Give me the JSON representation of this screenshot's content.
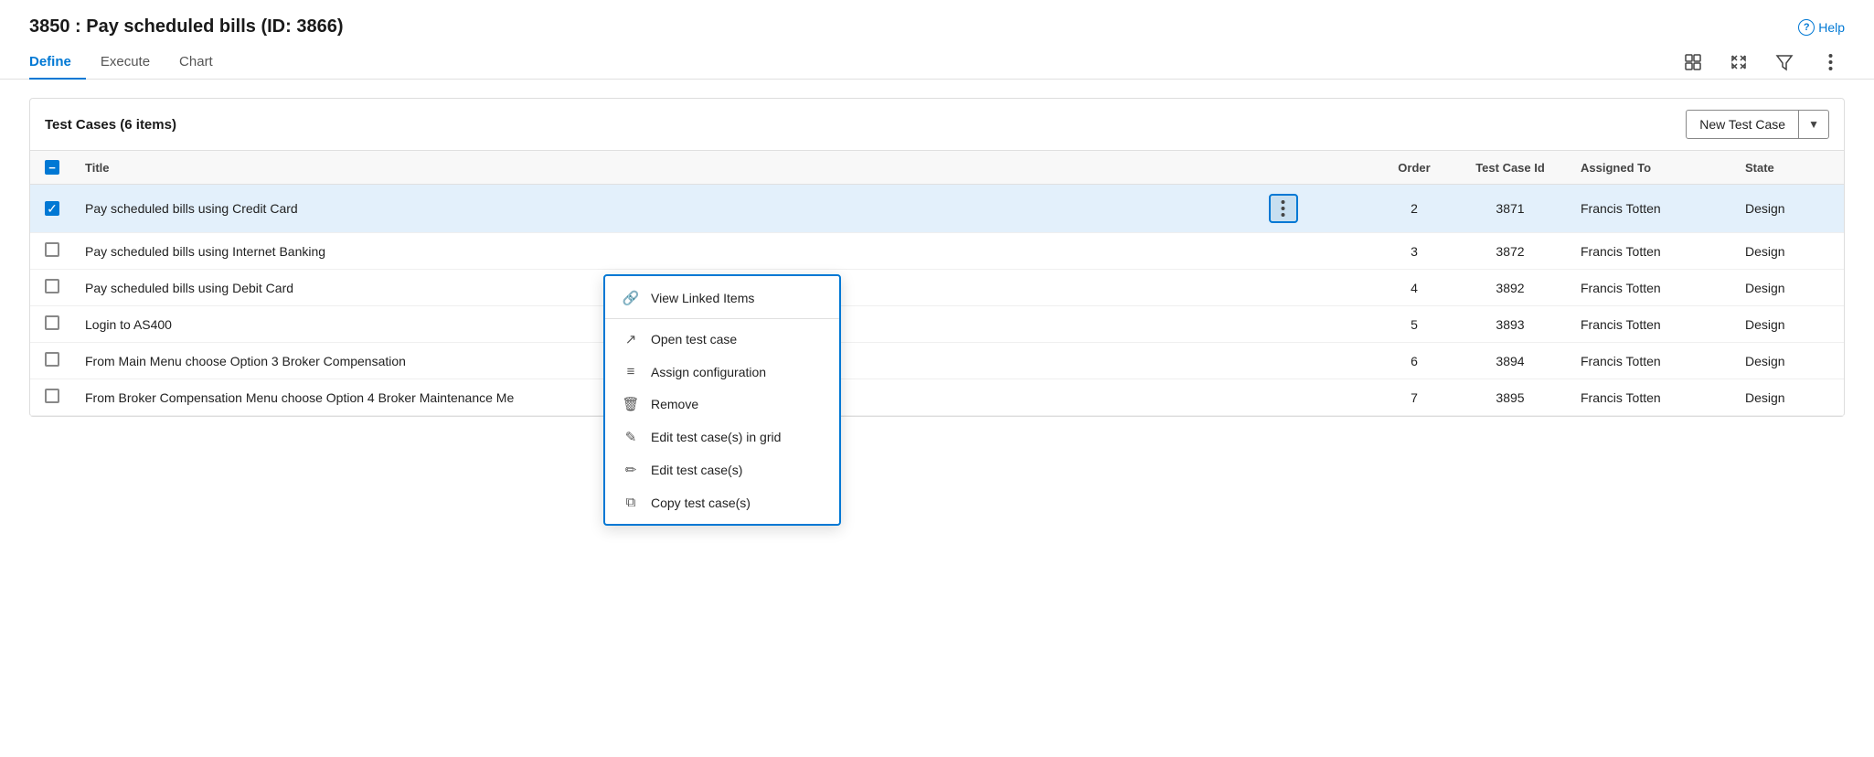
{
  "page": {
    "title": "3850 : Pay scheduled bills (ID: 3866)",
    "help_label": "Help"
  },
  "tabs": {
    "items": [
      {
        "id": "define",
        "label": "Define",
        "active": true
      },
      {
        "id": "execute",
        "label": "Execute",
        "active": false
      },
      {
        "id": "chart",
        "label": "Chart",
        "active": false
      }
    ]
  },
  "toolbar": {
    "grid_icon": "⊞",
    "expand_icon": "⤢",
    "filter_icon": "⊽",
    "more_icon": "⋮"
  },
  "panel": {
    "title": "Test Cases (6 items)",
    "new_btn_label": "New Test Case",
    "new_btn_chevron": "▼"
  },
  "table": {
    "columns": [
      "",
      "Title",
      "",
      "Order",
      "Test Case Id",
      "Assigned To",
      "State"
    ],
    "rows": [
      {
        "id": 1,
        "checked": true,
        "title": "Pay scheduled bills using Credit Card",
        "order": "2",
        "test_case_id": "3871",
        "assigned_to": "Francis Totten",
        "state": "Design",
        "selected": true,
        "show_menu": true
      },
      {
        "id": 2,
        "checked": false,
        "title": "Pay scheduled bills using Internet Banking",
        "order": "3",
        "test_case_id": "3872",
        "assigned_to": "Francis Totten",
        "state": "Design",
        "selected": false,
        "show_menu": false
      },
      {
        "id": 3,
        "checked": false,
        "title": "Pay scheduled bills using Debit Card",
        "order": "4",
        "test_case_id": "3892",
        "assigned_to": "Francis Totten",
        "state": "Design",
        "selected": false,
        "show_menu": false
      },
      {
        "id": 4,
        "checked": false,
        "title": "Login to AS400",
        "order": "5",
        "test_case_id": "3893",
        "assigned_to": "Francis Totten",
        "state": "Design",
        "selected": false,
        "show_menu": false
      },
      {
        "id": 5,
        "checked": false,
        "title": "From Main Menu choose Option 3 Broker Compensation",
        "order": "6",
        "test_case_id": "3894",
        "assigned_to": "Francis Totten",
        "state": "Design",
        "selected": false,
        "show_menu": false
      },
      {
        "id": 6,
        "checked": false,
        "title": "From Broker Compensation Menu choose Option 4 Broker Maintenance Me",
        "order": "7",
        "test_case_id": "3895",
        "assigned_to": "Francis Totten",
        "state": "Design",
        "selected": false,
        "show_menu": false
      }
    ]
  },
  "context_menu": {
    "visible": true,
    "items": [
      {
        "id": "view-linked",
        "icon": "🔗",
        "label": "View Linked Items",
        "divider_after": true
      },
      {
        "id": "open-test-case",
        "icon": "↗",
        "label": "Open test case",
        "divider_after": false
      },
      {
        "id": "assign-config",
        "icon": "≡",
        "label": "Assign configuration",
        "divider_after": false
      },
      {
        "id": "remove",
        "icon": "🗑",
        "label": "Remove",
        "divider_after": false
      },
      {
        "id": "edit-grid",
        "icon": "✎",
        "label": "Edit test case(s) in grid",
        "divider_after": false
      },
      {
        "id": "edit",
        "icon": "✏",
        "label": "Edit test case(s)",
        "divider_after": false
      },
      {
        "id": "copy",
        "icon": "⧉",
        "label": "Copy test case(s)",
        "divider_after": false
      }
    ]
  }
}
